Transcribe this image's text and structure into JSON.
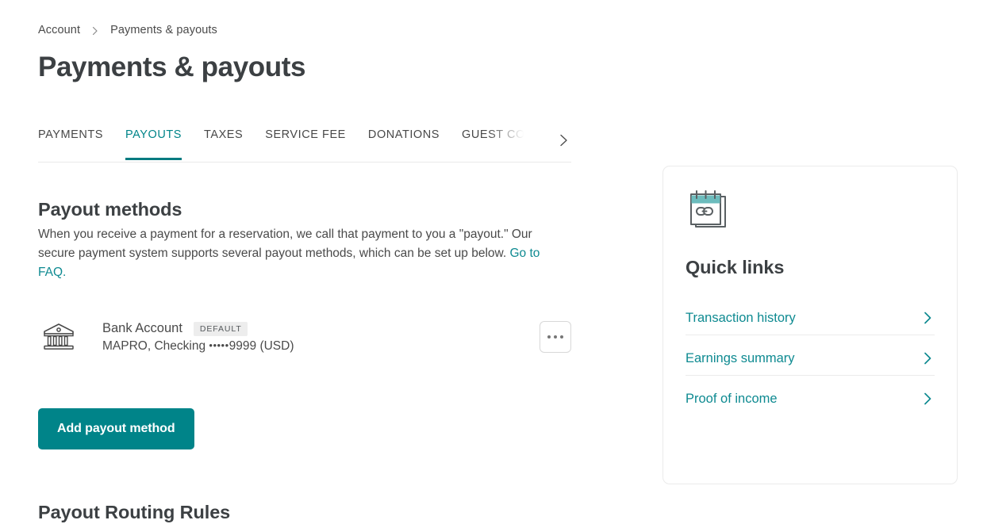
{
  "breadcrumb": {
    "parent": "Account",
    "separator_icon": "chevron-right-icon",
    "current": "Payments & payouts"
  },
  "header": {
    "title": "Payments & payouts"
  },
  "tabs": {
    "items": [
      {
        "label": "PAYMENTS",
        "active": false
      },
      {
        "label": "PAYOUTS",
        "active": true
      },
      {
        "label": "TAXES",
        "active": false
      },
      {
        "label": "SERVICE FEE",
        "active": false
      },
      {
        "label": "DONATIONS",
        "active": false
      },
      {
        "label": "GUEST CONTRIBUTIONS",
        "active": false
      }
    ],
    "next_icon": "chevron-right-icon"
  },
  "payout_methods": {
    "heading": "Payout methods",
    "description": "When you receive a payment for a reservation, we call that payment to you a \"payout.\" Our secure payment system supports several payout methods, which can be set up below. ",
    "faq_link": "Go to FAQ.",
    "method": {
      "icon": "bank-icon",
      "name": "Bank Account",
      "badge": "DEFAULT",
      "mask_dots": "•••••",
      "details_prefix": "MAPRO, Checking ",
      "details_digits": "9999",
      "details_suffix": " (USD)",
      "menu_icon": "ellipsis-icon"
    },
    "add_button": "Add payout method"
  },
  "routing_rules": {
    "heading": "Payout Routing Rules"
  },
  "quick_links": {
    "icon": "notepad-link-icon",
    "title": "Quick links",
    "chevron_icon": "chevron-right-icon",
    "items": [
      {
        "label": "Transaction history"
      },
      {
        "label": "Earnings summary"
      },
      {
        "label": "Proof of income"
      }
    ]
  },
  "colors": {
    "accent_teal": "#008489",
    "link_teal": "#0e8a91",
    "text_dark": "#3c4043",
    "text_body": "#4a4a4a",
    "border_light": "#ebebeb",
    "badge_bg": "#ededed",
    "icon_teal": "#6cbcbd"
  }
}
